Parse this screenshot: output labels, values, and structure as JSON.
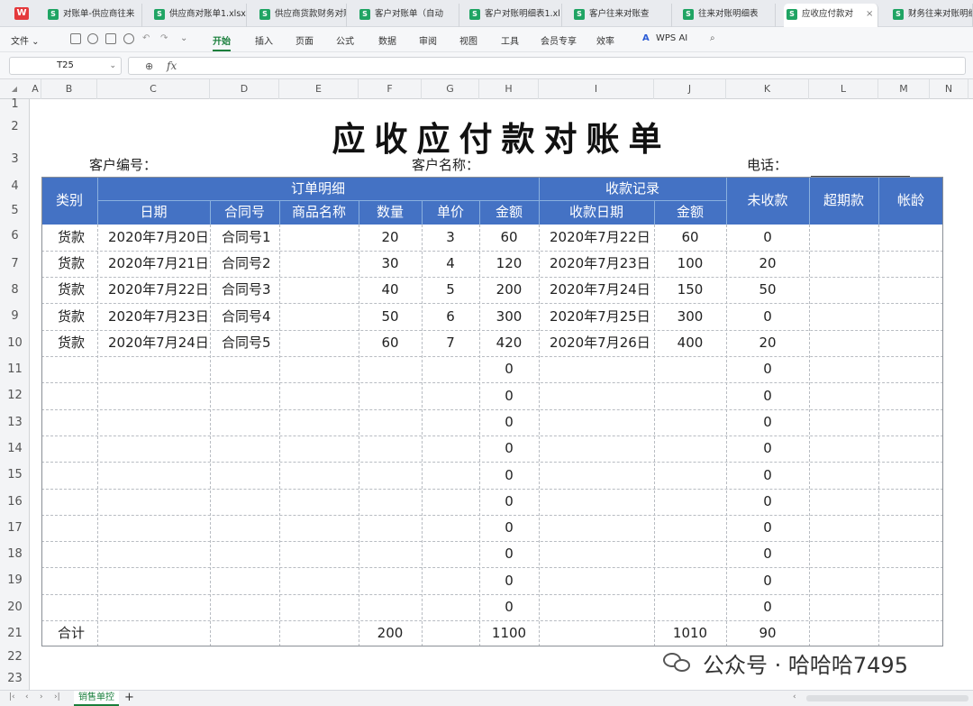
{
  "tabs": [
    {
      "label": "对账单-供应商往来",
      "active": false
    },
    {
      "label": "供应商对账单1.xlsx",
      "active": false
    },
    {
      "label": "供应商货款财务对账",
      "active": false
    },
    {
      "label": "客户对账单（自动",
      "active": false
    },
    {
      "label": "客户对账明细表1.xl",
      "active": false
    },
    {
      "label": "客户往来对账查",
      "active": false
    },
    {
      "label": "往来对账明细表",
      "active": false
    },
    {
      "label": "应收应付款对",
      "active": true
    },
    {
      "label": "财务往来对账明细",
      "active": false
    }
  ],
  "app_icon": "W",
  "sheet_icon": "S",
  "menu": [
    "文件",
    "开始",
    "插入",
    "页面",
    "公式",
    "数据",
    "审阅",
    "视图",
    "工具",
    "会员专享",
    "效率",
    "WPS AI"
  ],
  "formula_bar": {
    "name_box": "T25",
    "fx": "fx",
    "formula": ""
  },
  "columns": [
    "A",
    "B",
    "C",
    "D",
    "E",
    "F",
    "G",
    "H",
    "I",
    "J",
    "K",
    "L",
    "M",
    "N"
  ],
  "rows": [
    "1",
    "2",
    "3",
    "4",
    "5",
    "6",
    "7",
    "8",
    "9",
    "10",
    "11",
    "12",
    "13",
    "14",
    "15",
    "16",
    "17",
    "18",
    "19",
    "20",
    "21",
    "22",
    "23"
  ],
  "doc": {
    "title": "应收应付款对账单",
    "customer_no_label": "客户编号：",
    "customer_name_label": "客户名称：",
    "phone_label": "电话："
  },
  "table": {
    "header_color": "#4472c4",
    "h": {
      "category": "类别",
      "order_detail": "订单明细",
      "receipt_record": "收款记录",
      "unpaid": "未收款",
      "overdue": "超期款",
      "aging": "帐龄",
      "date": "日期",
      "contract": "合同号",
      "product": "商品名称",
      "qty": "数量",
      "price": "单价",
      "amount": "金额",
      "receipt_date": "收款日期",
      "receipt_amount": "金额"
    },
    "rows": [
      {
        "category": "货款",
        "date": "2020年7月20日",
        "contract": "合同号1",
        "product": "",
        "qty": "20",
        "price": "3",
        "amount": "60",
        "rdate": "2020年7月22日",
        "ramount": "60",
        "unpaid": "0",
        "overdue": "",
        "aging": ""
      },
      {
        "category": "货款",
        "date": "2020年7月21日",
        "contract": "合同号2",
        "product": "",
        "qty": "30",
        "price": "4",
        "amount": "120",
        "rdate": "2020年7月23日",
        "ramount": "100",
        "unpaid": "20",
        "overdue": "",
        "aging": ""
      },
      {
        "category": "货款",
        "date": "2020年7月22日",
        "contract": "合同号3",
        "product": "",
        "qty": "40",
        "price": "5",
        "amount": "200",
        "rdate": "2020年7月24日",
        "ramount": "150",
        "unpaid": "50",
        "overdue": "",
        "aging": ""
      },
      {
        "category": "货款",
        "date": "2020年7月23日",
        "contract": "合同号4",
        "product": "",
        "qty": "50",
        "price": "6",
        "amount": "300",
        "rdate": "2020年7月25日",
        "ramount": "300",
        "unpaid": "0",
        "overdue": "",
        "aging": ""
      },
      {
        "category": "货款",
        "date": "2020年7月24日",
        "contract": "合同号5",
        "product": "",
        "qty": "60",
        "price": "7",
        "amount": "420",
        "rdate": "2020年7月26日",
        "ramount": "400",
        "unpaid": "20",
        "overdue": "",
        "aging": ""
      },
      {
        "category": "",
        "date": "",
        "contract": "",
        "product": "",
        "qty": "",
        "price": "",
        "amount": "0",
        "rdate": "",
        "ramount": "",
        "unpaid": "0",
        "overdue": "",
        "aging": ""
      },
      {
        "category": "",
        "date": "",
        "contract": "",
        "product": "",
        "qty": "",
        "price": "",
        "amount": "0",
        "rdate": "",
        "ramount": "",
        "unpaid": "0",
        "overdue": "",
        "aging": ""
      },
      {
        "category": "",
        "date": "",
        "contract": "",
        "product": "",
        "qty": "",
        "price": "",
        "amount": "0",
        "rdate": "",
        "ramount": "",
        "unpaid": "0",
        "overdue": "",
        "aging": ""
      },
      {
        "category": "",
        "date": "",
        "contract": "",
        "product": "",
        "qty": "",
        "price": "",
        "amount": "0",
        "rdate": "",
        "ramount": "",
        "unpaid": "0",
        "overdue": "",
        "aging": ""
      },
      {
        "category": "",
        "date": "",
        "contract": "",
        "product": "",
        "qty": "",
        "price": "",
        "amount": "0",
        "rdate": "",
        "ramount": "",
        "unpaid": "0",
        "overdue": "",
        "aging": ""
      },
      {
        "category": "",
        "date": "",
        "contract": "",
        "product": "",
        "qty": "",
        "price": "",
        "amount": "0",
        "rdate": "",
        "ramount": "",
        "unpaid": "0",
        "overdue": "",
        "aging": ""
      },
      {
        "category": "",
        "date": "",
        "contract": "",
        "product": "",
        "qty": "",
        "price": "",
        "amount": "0",
        "rdate": "",
        "ramount": "",
        "unpaid": "0",
        "overdue": "",
        "aging": ""
      },
      {
        "category": "",
        "date": "",
        "contract": "",
        "product": "",
        "qty": "",
        "price": "",
        "amount": "0",
        "rdate": "",
        "ramount": "",
        "unpaid": "0",
        "overdue": "",
        "aging": ""
      },
      {
        "category": "",
        "date": "",
        "contract": "",
        "product": "",
        "qty": "",
        "price": "",
        "amount": "0",
        "rdate": "",
        "ramount": "",
        "unpaid": "0",
        "overdue": "",
        "aging": ""
      },
      {
        "category": "",
        "date": "",
        "contract": "",
        "product": "",
        "qty": "",
        "price": "",
        "amount": "0",
        "rdate": "",
        "ramount": "",
        "unpaid": "0",
        "overdue": "",
        "aging": ""
      }
    ],
    "total": {
      "category": "合计",
      "date": "",
      "contract": "",
      "product": "",
      "qty": "200",
      "price": "",
      "amount": "1100",
      "rdate": "",
      "ramount": "1010",
      "unpaid": "90",
      "overdue": "",
      "aging": ""
    }
  },
  "sheet_tabs": [
    "销售单控"
  ],
  "add_sheet": "+",
  "watermark": "公众号 · 哈哈哈7495"
}
